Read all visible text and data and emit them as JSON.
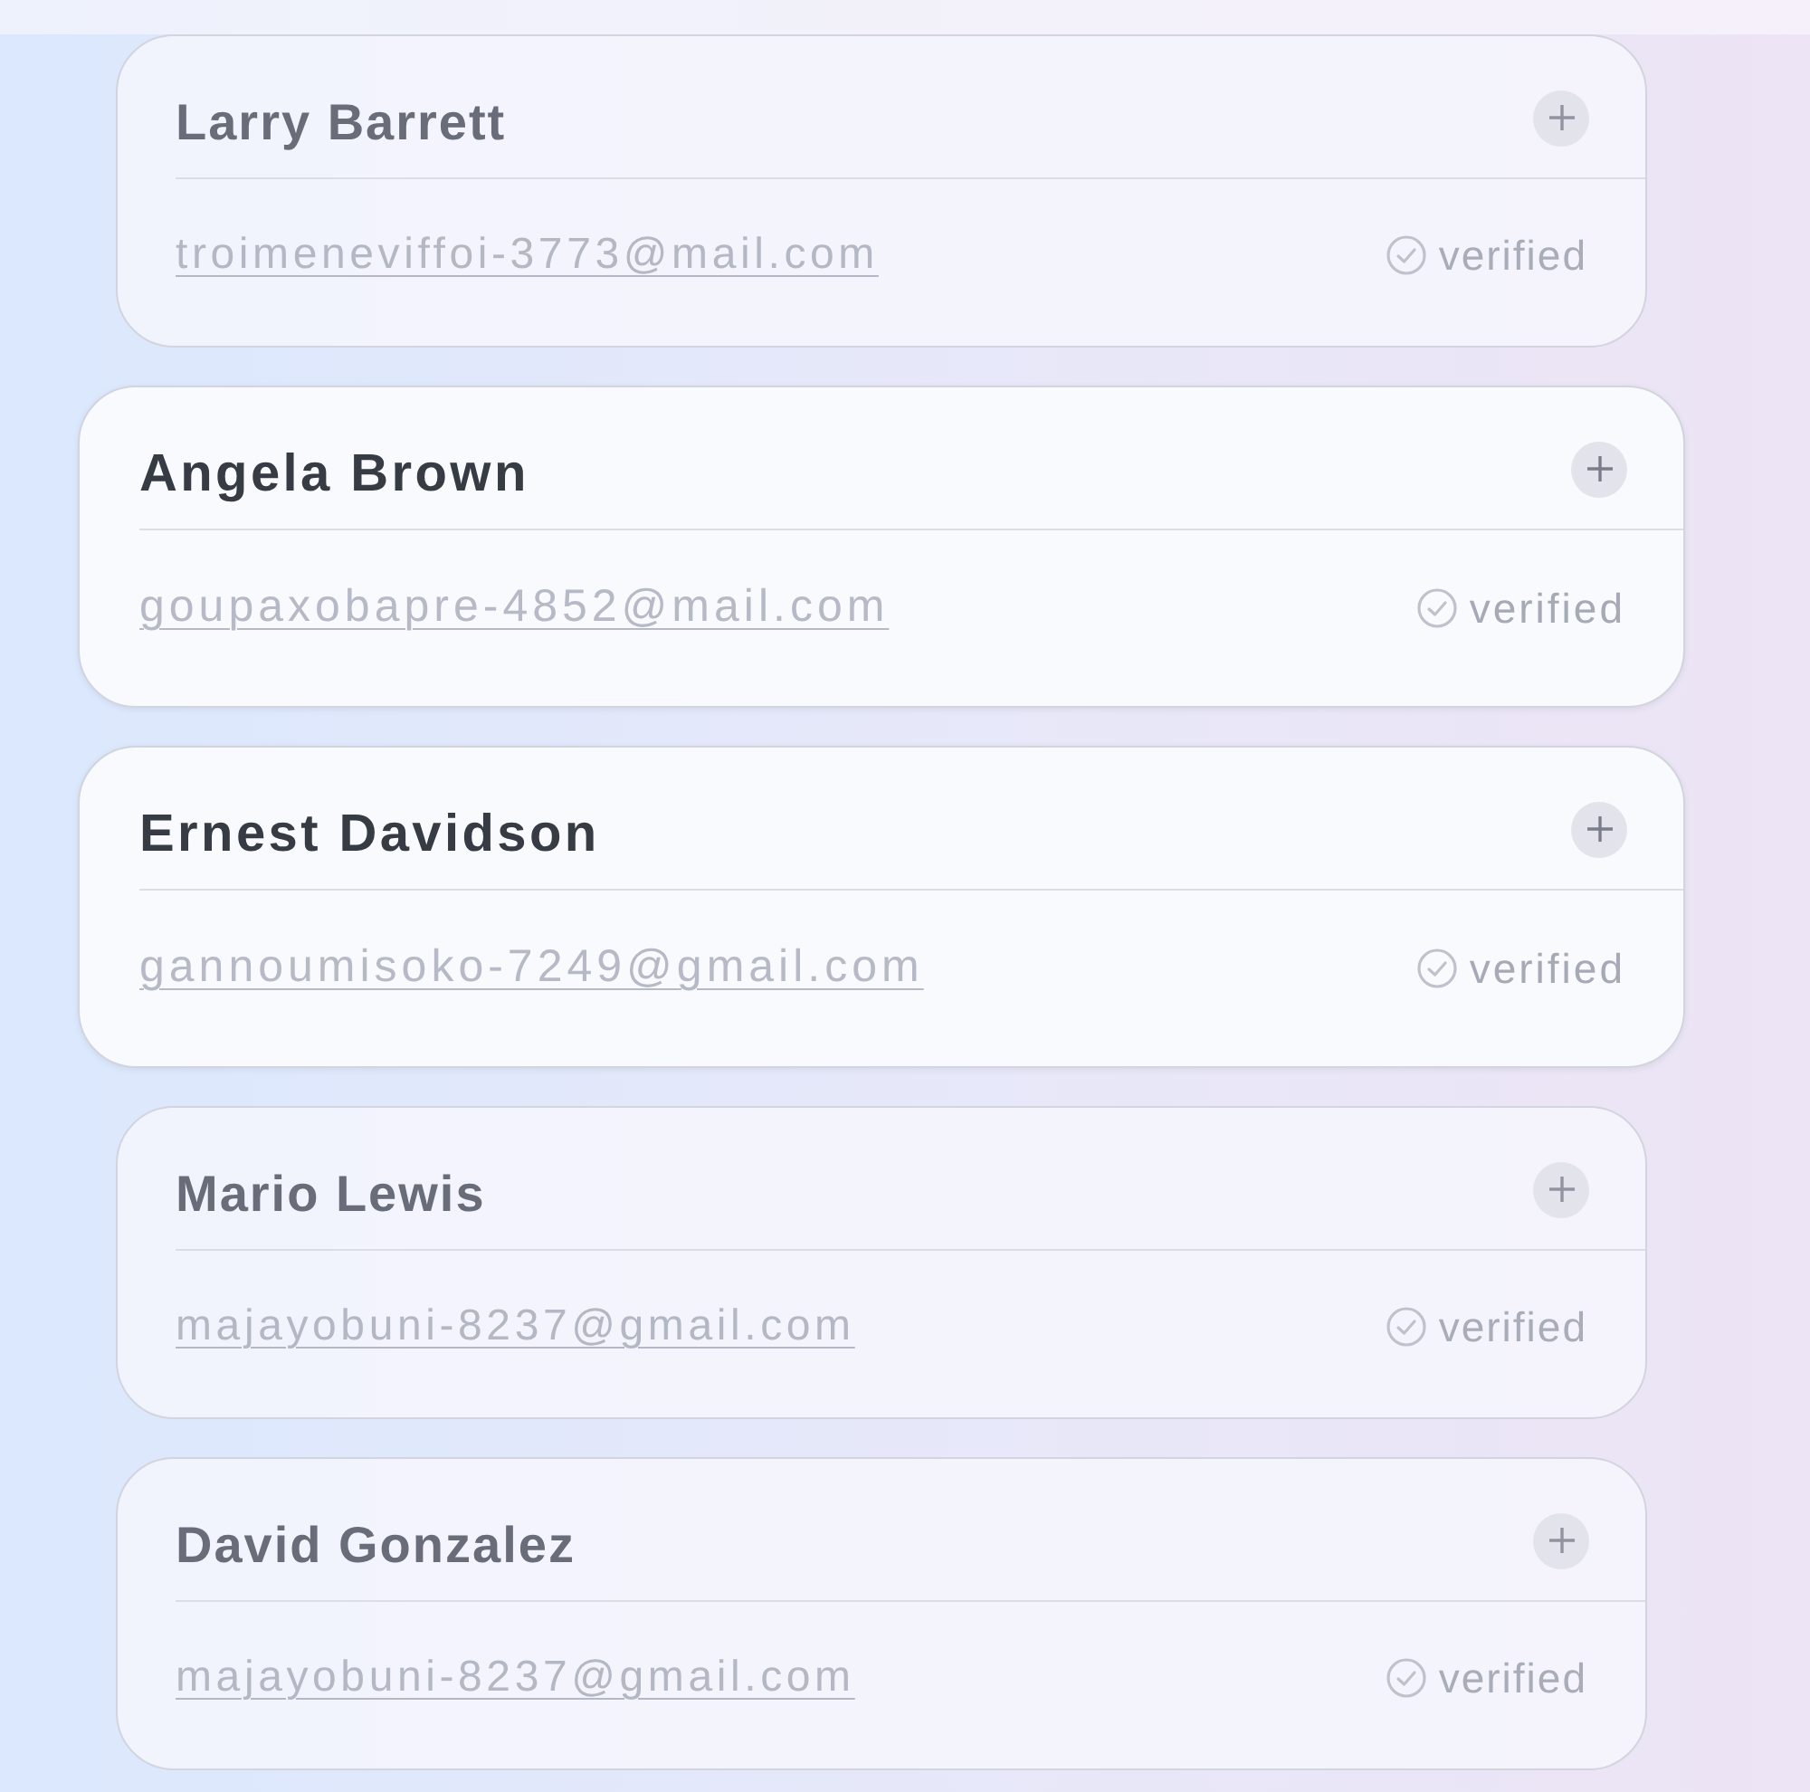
{
  "contacts": [
    {
      "name": "Larry Barrett",
      "email": "troimeneviffoi-3773@mail.com",
      "status": "verified",
      "selected": false
    },
    {
      "name": "Angela Brown",
      "email": "goupaxobapre-4852@mail.com",
      "status": "verified",
      "selected": true
    },
    {
      "name": "Ernest Davidson",
      "email": "gannoumisoko-7249@gmail.com",
      "status": "verified",
      "selected": true
    },
    {
      "name": "Mario Lewis",
      "email": "majayobuni-8237@gmail.com",
      "status": "verified",
      "selected": false
    },
    {
      "name": "David Gonzalez",
      "email": "majayobuni-8237@gmail.com",
      "status": "verified",
      "selected": false
    }
  ]
}
